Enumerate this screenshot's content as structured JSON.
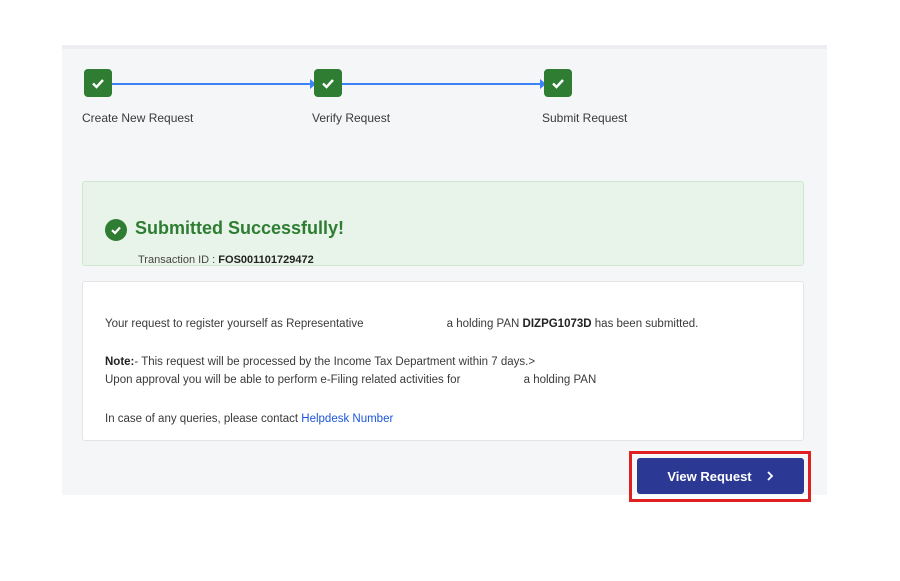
{
  "stepper": {
    "steps": [
      {
        "label": "Create New Request",
        "status": "complete"
      },
      {
        "label": "Verify Request",
        "status": "complete"
      },
      {
        "label": "Submit Request",
        "status": "complete"
      }
    ],
    "complete_color": "#2e7d32",
    "connector_color": "#3b82f6"
  },
  "success": {
    "title": "Submitted Successfully!",
    "transaction_label": "Transaction ID : ",
    "transaction_id": "FOS001101729472",
    "icon": "check-circle-icon"
  },
  "message": {
    "line1_prefix": "Your request to register yourself as Representative",
    "line1_mid": "a holding PAN ",
    "pan": "DIZPG1073D",
    "line1_suffix": " has been submitted.",
    "note_label": "Note:",
    "note_text": "-  This request will be processed by the Income Tax Department within 7 days.>",
    "line3_prefix": "Upon approval you will be able to perform e-Filing related activities for",
    "line3_mid": "a holding PAN",
    "contact_prefix": "In case of any queries, please contact ",
    "contact_link": "Helpdesk Number"
  },
  "actions": {
    "view_request_label": "View Request",
    "view_request_icon": "chevron-right-icon",
    "button_color": "#2b3994",
    "highlight_color": "#e02020"
  }
}
